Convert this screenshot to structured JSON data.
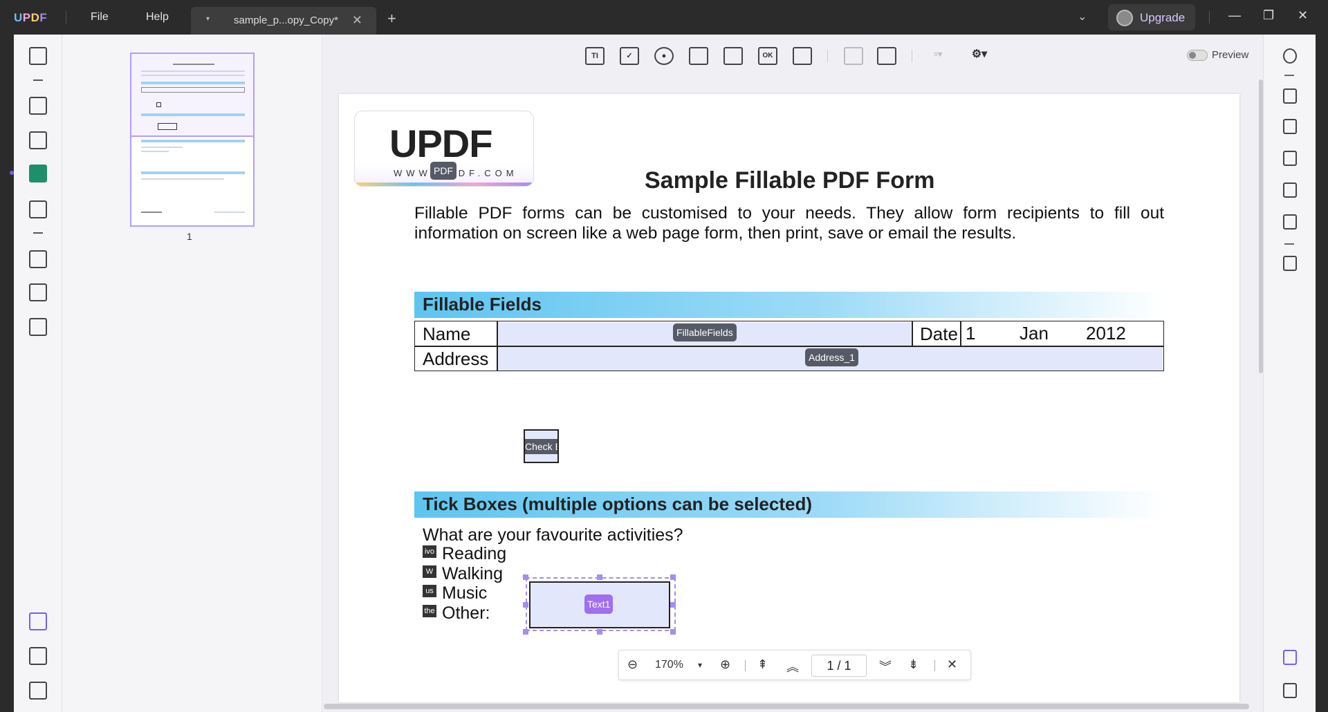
{
  "app": {
    "logo": "UPDF"
  },
  "menu": {
    "file": "File",
    "help": "Help"
  },
  "tab": {
    "title": "sample_p...opy_Copy*",
    "close": "✕",
    "dropdown": "▾"
  },
  "new_tab": "+",
  "upgrade": {
    "label": "Upgrade"
  },
  "window": {
    "minimize": "—",
    "restore": "❐",
    "close": "✕",
    "chevron": "⌄"
  },
  "thumbnails": {
    "page_number": "1"
  },
  "toolbar": {
    "text_field_icon": "TI",
    "ok_icon": "OK",
    "preview_label": "Preview"
  },
  "document": {
    "logo_text": "UPDF",
    "logo_url": "WWW.UPDF.COM",
    "logo_tag": "PDF",
    "title": "Sample Fillable PDF Form",
    "intro": "Fillable PDF forms can be customised to your needs. They allow form recipients to fill out information on screen like a web page form, then print, save or email the results.",
    "section1": "Fillable Fields",
    "name_label": "Name",
    "name_field_tag": "FillableFields",
    "date_label": "Date",
    "date_day": "1",
    "date_month": "Jan",
    "date_year": "2012",
    "address_label": "Address",
    "address_field_tag": "Address_1",
    "checkbox_tag": "Check Box",
    "section2": "Tick Boxes (multiple options can be selected)",
    "question": "What are your favourite activities?",
    "options": [
      {
        "box": "ivo",
        "label": "Reading"
      },
      {
        "box": "W",
        "label": "Walking"
      },
      {
        "box": "us",
        "label": "Music"
      },
      {
        "box": "the",
        "label": "Other:"
      }
    ],
    "text1_tag": "Text1"
  },
  "zoom": {
    "zoom_out": "⊖",
    "level": "170%",
    "dropdown": "▾",
    "zoom_in": "⊕",
    "first": "⇞",
    "prev": "︽",
    "page": "1 / 1",
    "next": "︾",
    "last": "⇟",
    "close": "✕"
  },
  "colors": {
    "accent": "#7a5cf0",
    "section_bar": "#5ec5f0",
    "field_fill": "#e3e7fb",
    "active_tool": "#1e8f6b"
  }
}
